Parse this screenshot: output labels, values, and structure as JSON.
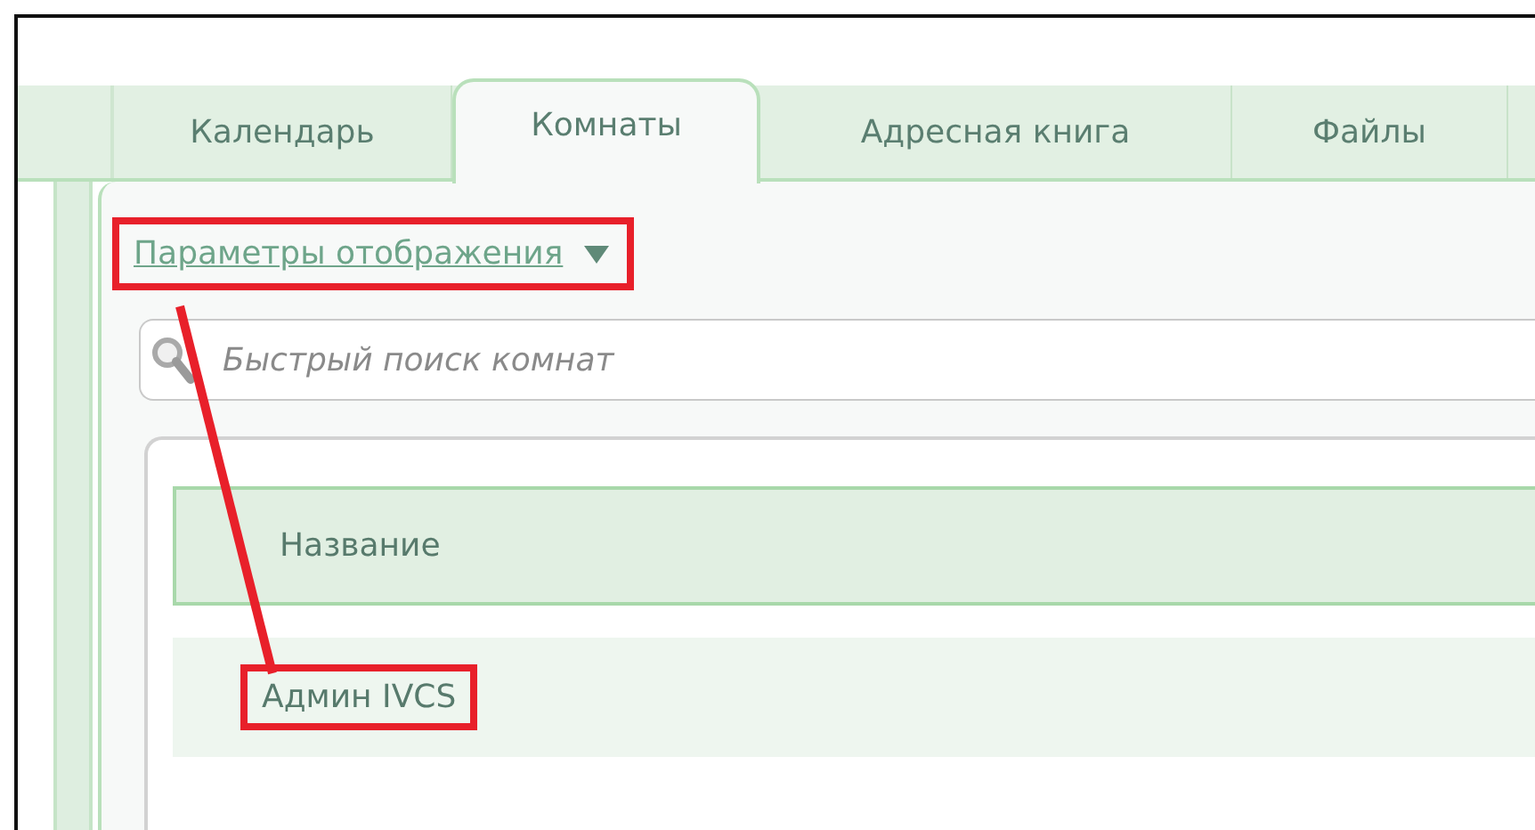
{
  "tabs": [
    {
      "label": "Календарь",
      "selected": false
    },
    {
      "label": "Комнаты",
      "selected": true
    },
    {
      "label": "Адресная книга",
      "selected": false
    },
    {
      "label": "Файлы",
      "selected": false
    }
  ],
  "display_options": {
    "label": "Параметры отображения"
  },
  "search": {
    "placeholder": "Быстрый поиск комнат"
  },
  "table": {
    "columns": [
      "Название"
    ],
    "rows": [
      {
        "name": "Админ IVCS"
      }
    ]
  }
}
